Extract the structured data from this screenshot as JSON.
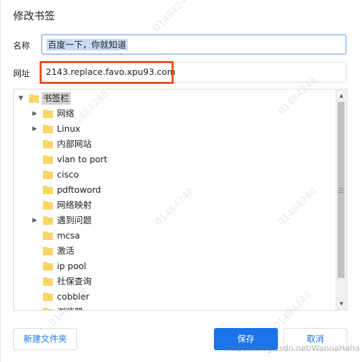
{
  "dialog": {
    "title": "修改书签"
  },
  "name_field": {
    "label": "名称",
    "value": "百度一下，你就知道"
  },
  "url_field": {
    "label": "网址",
    "value": "2143.replace.favo.xpu93.com"
  },
  "tree": {
    "root": {
      "label": "书签栏",
      "expanded": true
    },
    "items": [
      {
        "label": "网络",
        "has_children": true
      },
      {
        "label": "Linux",
        "has_children": true
      },
      {
        "label": "内部网站",
        "has_children": false
      },
      {
        "label": "vlan to port",
        "has_children": false
      },
      {
        "label": "cisco",
        "has_children": false
      },
      {
        "label": "pdftoword",
        "has_children": false
      },
      {
        "label": "网络映射",
        "has_children": false
      },
      {
        "label": "遇到问题",
        "has_children": true
      },
      {
        "label": "mcsa",
        "has_children": false
      },
      {
        "label": "激活",
        "has_children": false
      },
      {
        "label": "ip pool",
        "has_children": false
      },
      {
        "label": "社保查询",
        "has_children": false
      },
      {
        "label": "cobbler",
        "has_children": false
      },
      {
        "label": "浏览器",
        "has_children": false
      }
    ]
  },
  "buttons": {
    "new_folder": "新建文件夹",
    "save": "保存",
    "cancel": "取消"
  },
  "watermark": {
    "text": "01484248",
    "footer": "https://blog.csdn.net/WannaHaha"
  },
  "colors": {
    "accent": "#1a73e8",
    "highlight_border": "#e8511d",
    "folder": "#fdd663",
    "selection": "#c8dcf5"
  },
  "icons": {
    "folder": "folder-icon",
    "expand": "triangle-right-icon",
    "collapse": "triangle-down-icon"
  }
}
